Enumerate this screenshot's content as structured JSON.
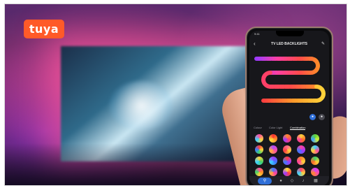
{
  "brand": {
    "logo_text": "tuya",
    "logo_color": "#ff5a28"
  },
  "app": {
    "status_time": "9:41",
    "title": "TV LED BACKLIGHTS",
    "back_icon": "back-arrow-icon",
    "edit_icon": "pencil-icon",
    "tabs": [
      {
        "label": "Colour",
        "active": false
      },
      {
        "label": "Color Light",
        "active": false
      },
      {
        "label": "Combination",
        "active": true
      }
    ],
    "nav_icons": [
      "search-icon",
      "bulb-icon",
      "tag-icon",
      "music-icon",
      "grid-icon"
    ]
  }
}
